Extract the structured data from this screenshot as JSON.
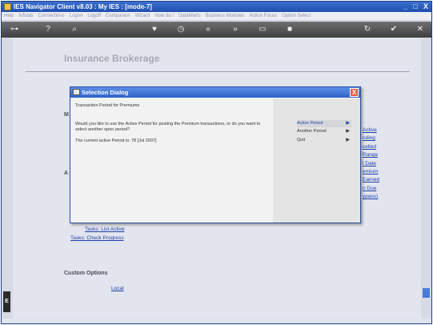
{
  "window": {
    "title": "IES Navigator Client v8.03 : My IES :      [mode-7]",
    "controls": [
      "_",
      "□",
      "X"
    ]
  },
  "menubar": [
    "Help",
    "Infolab",
    "Connections",
    "Logon",
    "Logoff",
    "Companion",
    "Wizard",
    "How do I",
    "DataMarts",
    "Business Modules",
    "Action Focus",
    "Option Select"
  ],
  "toolbar": {
    "icons": [
      "key-icon",
      "help-icon",
      "search-icon",
      "heart-icon",
      "clock-icon",
      "back-icon",
      "forward-icon",
      "doc-icon",
      "stop-icon",
      "refresh-icon",
      "ok-icon",
      "close-icon"
    ]
  },
  "page": {
    "title": "Insurance Brokerage",
    "bg_labels": [
      "M",
      "A",
      "Custom Options"
    ],
    "links_right": [
      "Active",
      "nding",
      "celled",
      "Range",
      "l Date",
      "emium",
      "Earned",
      "n Due",
      "ypass)"
    ],
    "links_bottom": [
      "Tasks: List Active",
      "Tasks: Check Progress"
    ],
    "custom_local": "Local",
    "side_tab": "E"
  },
  "dialog": {
    "title": "Selection Dialog",
    "close": "X",
    "heading": "Transaction Period for Premiums",
    "question_line1": "Would you like to use the Active Period for posting the Premium transactions, or do you want to",
    "question_line2": "select another open period?",
    "current_period": "The current active Period is: 78  [Jul 2007]",
    "options": [
      {
        "label": "Active Period",
        "arrow": "▶"
      },
      {
        "label": "Another Period",
        "arrow": "▶"
      },
      {
        "label": "Quit",
        "arrow": "▶"
      }
    ]
  }
}
